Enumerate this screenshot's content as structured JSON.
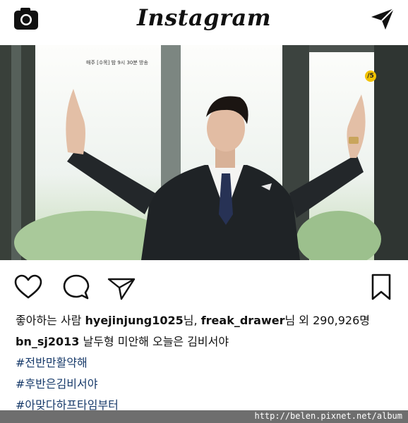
{
  "header": {
    "logo_text": "Instagram",
    "camera_icon": "camera-icon",
    "direct_icon": "paper-plane-icon"
  },
  "post": {
    "overlay_text": "매주 [수목] 밤 9시 30분 방송",
    "channel_badge": "/5"
  },
  "actions": {
    "like_icon": "heart-icon",
    "comment_icon": "comment-icon",
    "share_icon": "send-icon",
    "save_icon": "bookmark-icon"
  },
  "likes": {
    "prefix": "좋아하는 사람 ",
    "user1": "hyejinjung1025",
    "sep": "님, ",
    "user2": "freak_drawer",
    "suffix": "님 외 290,926명"
  },
  "caption": {
    "username": "bn_sj2013",
    "text": " 날두형 미안해 오늘은 김비서야"
  },
  "hashtags": [
    "#전반만활약해",
    "#후반은김비서야",
    "#아맞다하프타임부터"
  ],
  "watermark": "http://belen.pixnet.net/album"
}
